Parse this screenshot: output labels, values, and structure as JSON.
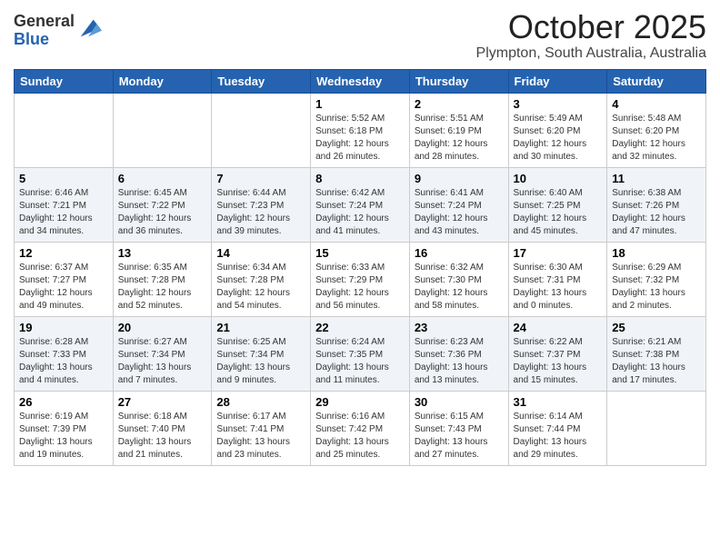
{
  "header": {
    "logo_general": "General",
    "logo_blue": "Blue",
    "month_title": "October 2025",
    "location": "Plympton, South Australia, Australia"
  },
  "days_of_week": [
    "Sunday",
    "Monday",
    "Tuesday",
    "Wednesday",
    "Thursday",
    "Friday",
    "Saturday"
  ],
  "weeks": [
    [
      {
        "day": "",
        "info": ""
      },
      {
        "day": "",
        "info": ""
      },
      {
        "day": "",
        "info": ""
      },
      {
        "day": "1",
        "info": "Sunrise: 5:52 AM\nSunset: 6:18 PM\nDaylight: 12 hours\nand 26 minutes."
      },
      {
        "day": "2",
        "info": "Sunrise: 5:51 AM\nSunset: 6:19 PM\nDaylight: 12 hours\nand 28 minutes."
      },
      {
        "day": "3",
        "info": "Sunrise: 5:49 AM\nSunset: 6:20 PM\nDaylight: 12 hours\nand 30 minutes."
      },
      {
        "day": "4",
        "info": "Sunrise: 5:48 AM\nSunset: 6:20 PM\nDaylight: 12 hours\nand 32 minutes."
      }
    ],
    [
      {
        "day": "5",
        "info": "Sunrise: 6:46 AM\nSunset: 7:21 PM\nDaylight: 12 hours\nand 34 minutes."
      },
      {
        "day": "6",
        "info": "Sunrise: 6:45 AM\nSunset: 7:22 PM\nDaylight: 12 hours\nand 36 minutes."
      },
      {
        "day": "7",
        "info": "Sunrise: 6:44 AM\nSunset: 7:23 PM\nDaylight: 12 hours\nand 39 minutes."
      },
      {
        "day": "8",
        "info": "Sunrise: 6:42 AM\nSunset: 7:24 PM\nDaylight: 12 hours\nand 41 minutes."
      },
      {
        "day": "9",
        "info": "Sunrise: 6:41 AM\nSunset: 7:24 PM\nDaylight: 12 hours\nand 43 minutes."
      },
      {
        "day": "10",
        "info": "Sunrise: 6:40 AM\nSunset: 7:25 PM\nDaylight: 12 hours\nand 45 minutes."
      },
      {
        "day": "11",
        "info": "Sunrise: 6:38 AM\nSunset: 7:26 PM\nDaylight: 12 hours\nand 47 minutes."
      }
    ],
    [
      {
        "day": "12",
        "info": "Sunrise: 6:37 AM\nSunset: 7:27 PM\nDaylight: 12 hours\nand 49 minutes."
      },
      {
        "day": "13",
        "info": "Sunrise: 6:35 AM\nSunset: 7:28 PM\nDaylight: 12 hours\nand 52 minutes."
      },
      {
        "day": "14",
        "info": "Sunrise: 6:34 AM\nSunset: 7:28 PM\nDaylight: 12 hours\nand 54 minutes."
      },
      {
        "day": "15",
        "info": "Sunrise: 6:33 AM\nSunset: 7:29 PM\nDaylight: 12 hours\nand 56 minutes."
      },
      {
        "day": "16",
        "info": "Sunrise: 6:32 AM\nSunset: 7:30 PM\nDaylight: 12 hours\nand 58 minutes."
      },
      {
        "day": "17",
        "info": "Sunrise: 6:30 AM\nSunset: 7:31 PM\nDaylight: 13 hours\nand 0 minutes."
      },
      {
        "day": "18",
        "info": "Sunrise: 6:29 AM\nSunset: 7:32 PM\nDaylight: 13 hours\nand 2 minutes."
      }
    ],
    [
      {
        "day": "19",
        "info": "Sunrise: 6:28 AM\nSunset: 7:33 PM\nDaylight: 13 hours\nand 4 minutes."
      },
      {
        "day": "20",
        "info": "Sunrise: 6:27 AM\nSunset: 7:34 PM\nDaylight: 13 hours\nand 7 minutes."
      },
      {
        "day": "21",
        "info": "Sunrise: 6:25 AM\nSunset: 7:34 PM\nDaylight: 13 hours\nand 9 minutes."
      },
      {
        "day": "22",
        "info": "Sunrise: 6:24 AM\nSunset: 7:35 PM\nDaylight: 13 hours\nand 11 minutes."
      },
      {
        "day": "23",
        "info": "Sunrise: 6:23 AM\nSunset: 7:36 PM\nDaylight: 13 hours\nand 13 minutes."
      },
      {
        "day": "24",
        "info": "Sunrise: 6:22 AM\nSunset: 7:37 PM\nDaylight: 13 hours\nand 15 minutes."
      },
      {
        "day": "25",
        "info": "Sunrise: 6:21 AM\nSunset: 7:38 PM\nDaylight: 13 hours\nand 17 minutes."
      }
    ],
    [
      {
        "day": "26",
        "info": "Sunrise: 6:19 AM\nSunset: 7:39 PM\nDaylight: 13 hours\nand 19 minutes."
      },
      {
        "day": "27",
        "info": "Sunrise: 6:18 AM\nSunset: 7:40 PM\nDaylight: 13 hours\nand 21 minutes."
      },
      {
        "day": "28",
        "info": "Sunrise: 6:17 AM\nSunset: 7:41 PM\nDaylight: 13 hours\nand 23 minutes."
      },
      {
        "day": "29",
        "info": "Sunrise: 6:16 AM\nSunset: 7:42 PM\nDaylight: 13 hours\nand 25 minutes."
      },
      {
        "day": "30",
        "info": "Sunrise: 6:15 AM\nSunset: 7:43 PM\nDaylight: 13 hours\nand 27 minutes."
      },
      {
        "day": "31",
        "info": "Sunrise: 6:14 AM\nSunset: 7:44 PM\nDaylight: 13 hours\nand 29 minutes."
      },
      {
        "day": "",
        "info": ""
      }
    ]
  ]
}
